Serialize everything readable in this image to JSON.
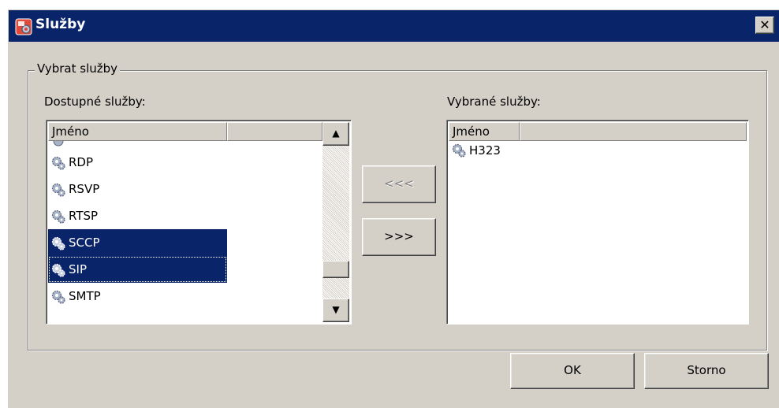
{
  "window": {
    "title": "Služby"
  },
  "group": {
    "label": "Vybrat služby"
  },
  "available": {
    "label": "Dostupné služby:",
    "columns": [
      "Jméno",
      ""
    ],
    "items": [
      {
        "name": "RDP",
        "selected": false
      },
      {
        "name": "RSVP",
        "selected": false
      },
      {
        "name": "RTSP",
        "selected": false
      },
      {
        "name": "SCCP",
        "selected": true
      },
      {
        "name": "SIP",
        "selected": true
      },
      {
        "name": "SMTP",
        "selected": false
      }
    ],
    "scroll_position": 0.85
  },
  "selected_list": {
    "label": "Vybrané služby:",
    "columns": [
      "Jméno",
      ""
    ],
    "items": [
      {
        "name": "H323"
      }
    ]
  },
  "buttons": {
    "remove_label": "<<<",
    "add_label": ">>>",
    "ok_label": "OK",
    "cancel_label": "Storno"
  },
  "icons": {
    "app": "services-icon",
    "item": "gear-icon",
    "close": "close-icon"
  },
  "colors": {
    "titlebar": "#0a246a",
    "selection": "#0a246a",
    "dialog_bg": "#d4d0c8"
  }
}
